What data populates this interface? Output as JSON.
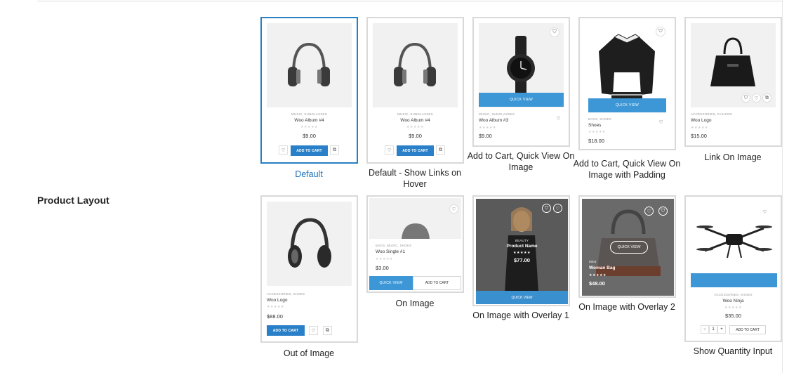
{
  "section": {
    "label": "Product Layout"
  },
  "options": {
    "o1": {
      "label": "Default",
      "cat": "MUSIC, SUNGLASSES",
      "name": "Woo Album #4",
      "stars": "★★★★★",
      "price": "$9.00",
      "cart": "ADD TO CART"
    },
    "o2": {
      "label": "Default - Show Links on Hover",
      "cat": "MUSIC, SUNGLASSES",
      "name": "Woo Album #4",
      "stars": "★★★★★",
      "price": "$9.00",
      "cart": "ADD TO CART"
    },
    "o3": {
      "label": "Add to Cart, Quick View On Image",
      "cat": "MUSIC, SUNGLASSES",
      "name": "Woo Album #3",
      "stars": "★★★★★",
      "price": "$9.00",
      "quick": "QUICK VIEW"
    },
    "o4": {
      "label": "Add to Cart, Quick View On Image with Padding",
      "cat": "BAGS, SHOES",
      "name": "Shoes",
      "stars": "★★★★★",
      "price": "$18.00",
      "quick": "QUICK VIEW"
    },
    "o5": {
      "label": "Link On Image",
      "cat": "ACCESSORIES, FASHION",
      "name": "Woo Logo",
      "stars": "★★★★★",
      "price": "$15.00"
    },
    "o6": {
      "label": "Out of Image",
      "cat": "ACCESSORIES, SHOES",
      "name": "Woo Logo",
      "stars": "★★★★★",
      "price": "$88.00",
      "cart": "ADD TO CART"
    },
    "o7": {
      "label": "On Image",
      "cat": "BAGS, MUSIC, SHOES",
      "name": "Woo Single #1",
      "stars": "★★★★★",
      "price": "$3.00",
      "quick": "QUICK VIEW",
      "cart": "ADD TO CART"
    },
    "o8": {
      "label": "On Image with Overlay 1",
      "cat": "BEAUTY",
      "name": "Product Name",
      "stars": "★★★★★",
      "price": "$77.00",
      "quick": "QUICK VIEW"
    },
    "o9": {
      "label": "On Image with Overlay 2",
      "cat": "MEN",
      "name": "Woman Bag",
      "stars": "★★★★★",
      "price": "$48.00",
      "quick": "QUICK VIEW"
    },
    "o10": {
      "label": "Show Quantity Input",
      "cat": "ACCESSORIES, SHOES",
      "name": "Woo Ninja",
      "stars": "★★★★★",
      "price": "$35.00",
      "qty": "1",
      "minus": "−",
      "plus": "+",
      "cart": "ADD TO CART"
    }
  },
  "icons": {
    "heart": "♡",
    "bag": "⛉",
    "link": "⧉"
  },
  "colors": {
    "accent": "#2a7fc1",
    "button": "#2a80c8",
    "quickview": "#3d97d6"
  }
}
